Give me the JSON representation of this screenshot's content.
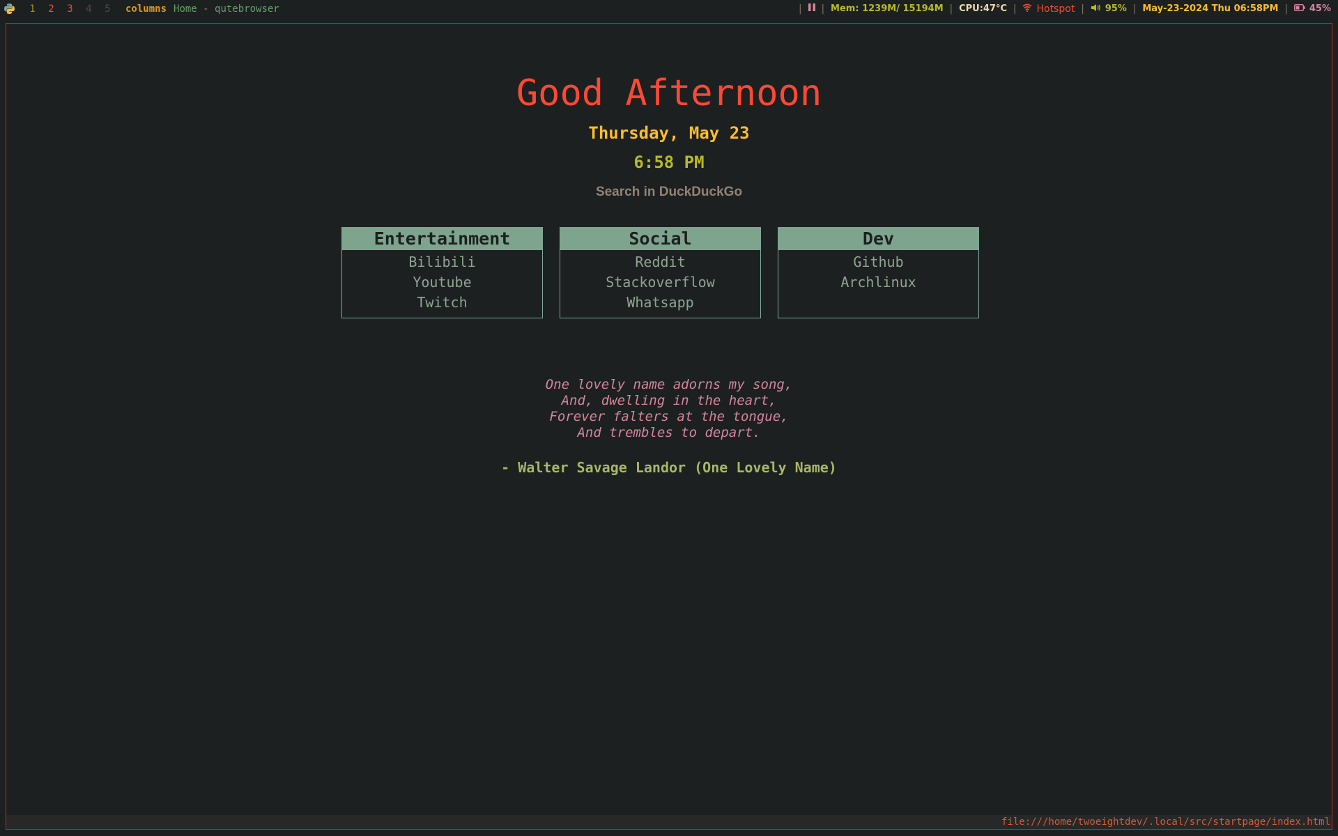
{
  "topbar": {
    "workspaces": [
      {
        "label": "1",
        "color": "#98971a"
      },
      {
        "label": "2",
        "color": "#fb4934"
      },
      {
        "label": "3",
        "color": "#fb4934"
      },
      {
        "label": "4",
        "color": "#504945"
      },
      {
        "label": "5",
        "color": "#504945"
      }
    ],
    "layout": "columns",
    "window_title": "Home - qutebrowser",
    "mem": "Mem: 1239M/ 15194M",
    "cpu": "CPU:47°C",
    "wifi": "Hotspot",
    "volume": "95%",
    "datetime": "May-23-2024 Thu 06:58PM",
    "battery": "45%"
  },
  "page": {
    "greeting": "Good Afternoon",
    "date": "Thursday, May 23",
    "time": "6:58 PM",
    "search_placeholder": "Search in DuckDuckGo",
    "boxes": [
      {
        "title": "Entertainment",
        "links": [
          "Bilibili",
          "Youtube",
          "Twitch"
        ]
      },
      {
        "title": "Social",
        "links": [
          "Reddit",
          "Stackoverflow",
          "Whatsapp"
        ]
      },
      {
        "title": "Dev",
        "links": [
          "Github",
          "Archlinux"
        ]
      }
    ],
    "quote_lines": [
      "One lovely name adorns my song,",
      "And, dwelling in the heart,",
      "Forever falters at the tongue,",
      "And trembles to depart."
    ],
    "quote_author": "- Walter Savage Landor (One Lovely Name)"
  },
  "status_url": "file:///home/twoeightdev/.local/src/startpage/index.html",
  "colors": {
    "background": "#1d2021",
    "accent_red": "#fb4934",
    "accent_yellow": "#fabd2f",
    "box_header": "#7fa48e"
  }
}
